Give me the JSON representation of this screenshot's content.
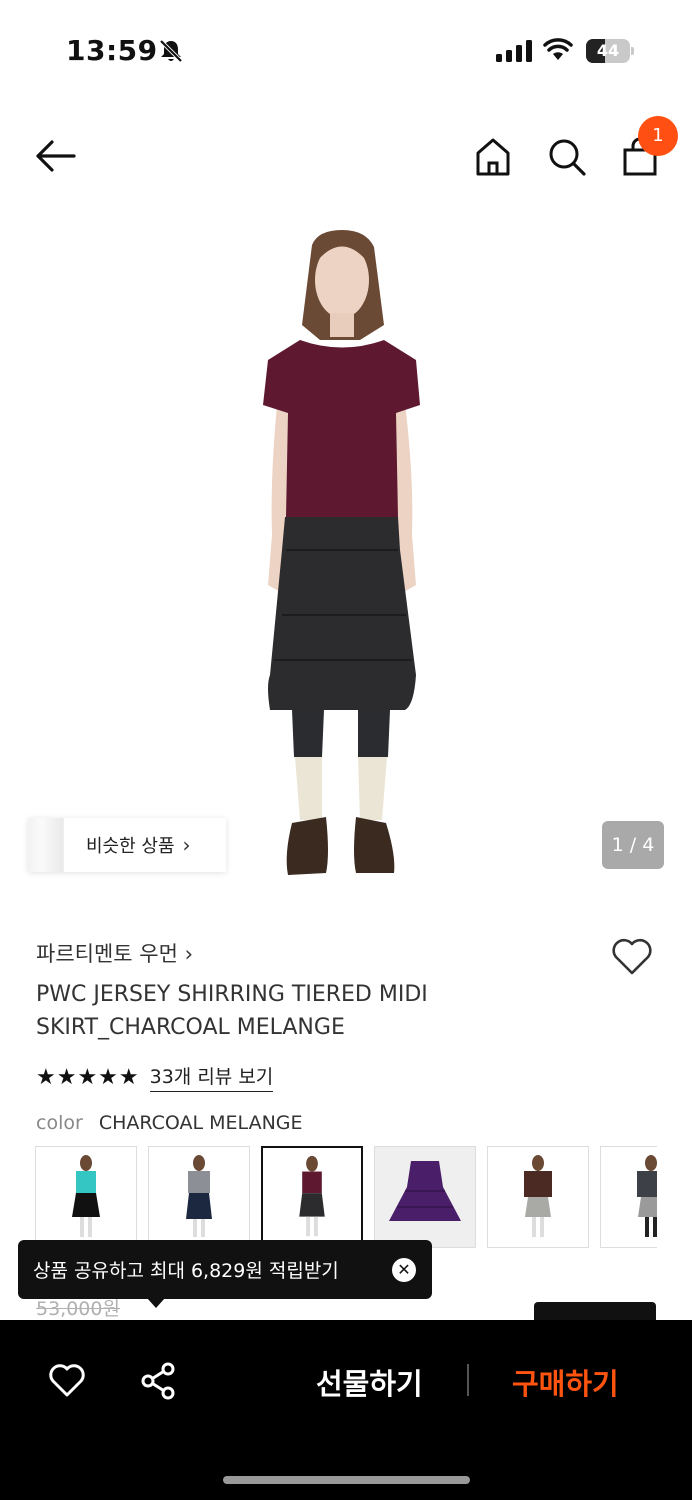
{
  "status_bar": {
    "time": "13:59",
    "battery": "44",
    "battery_level": 0.44
  },
  "header": {
    "cart_count": "1"
  },
  "gallery": {
    "similar_label": "비슷한 상품",
    "similar_chevron": "›",
    "page_indicator": "1 / 4"
  },
  "product": {
    "brand": "파르티멘토 우먼 ›",
    "name": "PWC JERSEY SHIRRING TIERED MIDI SKIRT_CHARCOAL MELANGE",
    "stars": "★★★★★",
    "rating": 5,
    "review_link": "33개 리뷰 보기",
    "color_label": "color",
    "color_value": "CHARCOAL MELANGE",
    "swatches": [
      {
        "name": "teal-top-black-skirt"
      },
      {
        "name": "grey-top-navy-skirt"
      },
      {
        "name": "burgundy-top-charcoal-skirt",
        "selected": true
      },
      {
        "name": "purple-skirt-flat"
      },
      {
        "name": "brown-hoodie-grey-skirt"
      },
      {
        "name": "grey-hoodie-skirt"
      }
    ],
    "original_price": "53,000원"
  },
  "tooltip": {
    "text": "상품 공유하고 최대 6,829원 적립받기",
    "close": "✕"
  },
  "bottom_bar": {
    "gift_label": "선물하기",
    "buy_label": "구매하기"
  },
  "colors": {
    "accent": "#ff5410",
    "badge": "#ff4f12",
    "bar": "#000000"
  },
  "icons": [
    "back-arrow-icon",
    "home-icon",
    "search-icon",
    "shopping-bag-icon",
    "heart-icon",
    "share-icon",
    "close-icon",
    "bell-off-icon",
    "signal-icon",
    "wifi-icon",
    "battery-icon"
  ]
}
